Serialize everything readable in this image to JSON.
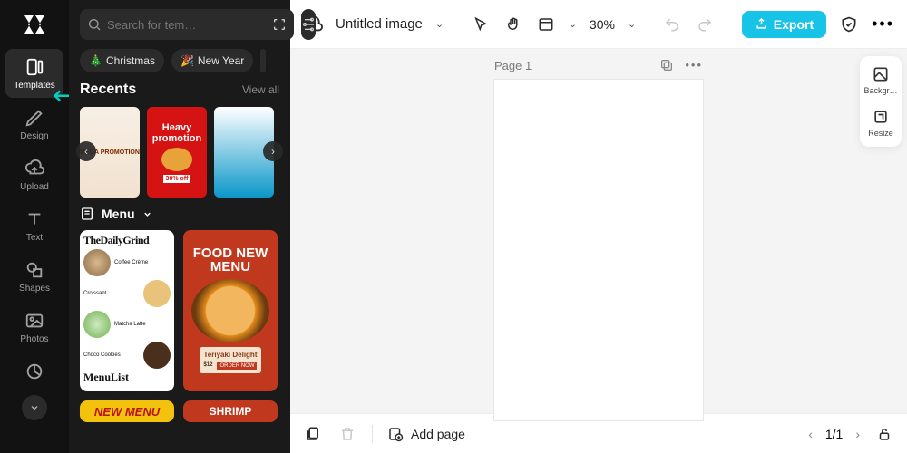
{
  "rail": {
    "items": [
      {
        "label": "Templates"
      },
      {
        "label": "Design"
      },
      {
        "label": "Upload"
      },
      {
        "label": "Text"
      },
      {
        "label": "Shapes"
      },
      {
        "label": "Photos"
      }
    ]
  },
  "panel": {
    "search_placeholder": "Search for tem…",
    "chips": [
      {
        "emoji": "🎄",
        "label": "Christmas"
      },
      {
        "emoji": "🎉",
        "label": "New Year"
      }
    ],
    "recents_title": "Recents",
    "view_all": "View all",
    "recents": [
      {
        "line1": "MEGA PROMOTION"
      },
      {
        "line1": "Heavy",
        "line2": "promotion",
        "badge": "30% off"
      },
      {
        "line1": ""
      }
    ],
    "menu_label": "Menu",
    "templates": {
      "a": {
        "head": "TheDailyGrind",
        "foot": "MenuList",
        "rows": [
          "Coffee Crème",
          "Croissant",
          "Matcha Latte",
          "Choco Cookies"
        ]
      },
      "b": {
        "head": "FOOD NEW MENU",
        "dish": "Teriyaki Delight",
        "price": "$12",
        "cta": "ORDER NOW"
      },
      "c": {
        "text": "NEW MENU"
      },
      "d": {
        "text": "SHRIMP"
      }
    }
  },
  "topbar": {
    "title": "Untitled image",
    "zoom": "30%",
    "export": "Export"
  },
  "stage": {
    "page_label": "Page 1",
    "side": [
      {
        "label": "Backgr…"
      },
      {
        "label": "Resize"
      }
    ]
  },
  "bottombar": {
    "add_page": "Add page",
    "page_indicator": "1/1"
  }
}
